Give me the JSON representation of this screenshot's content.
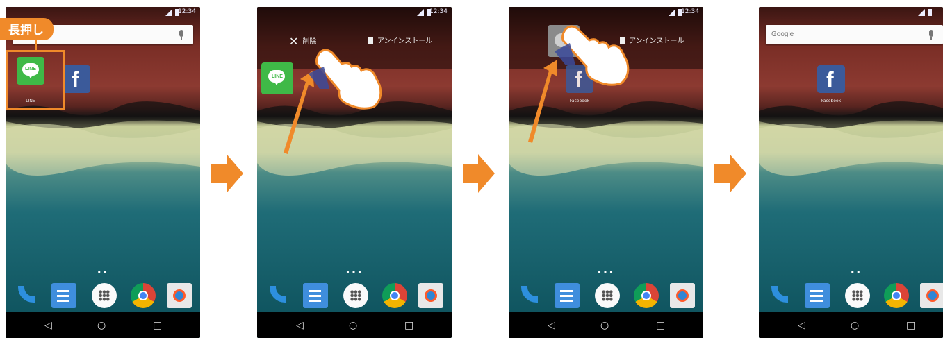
{
  "status_bar": {
    "time": "12:34"
  },
  "callout": {
    "label": "長押し"
  },
  "search": {
    "logo": "Google"
  },
  "dropbar": {
    "remove": "削除",
    "uninstall": "アンインストール"
  },
  "apps": {
    "line": "LINE",
    "facebook": "Facebook"
  },
  "page_dots": [
    "••",
    "•••",
    "•••",
    "••"
  ],
  "colors": {
    "accent": "#f08a2a",
    "line_green": "#3fb947",
    "facebook_blue": "#3b5a9a",
    "dock_blue": "#2d8fde"
  },
  "nav_icons": [
    "back-icon",
    "home-icon",
    "recents-icon"
  ],
  "nav_glyphs": {
    "back": "◁",
    "home": "○",
    "recents": "□"
  }
}
